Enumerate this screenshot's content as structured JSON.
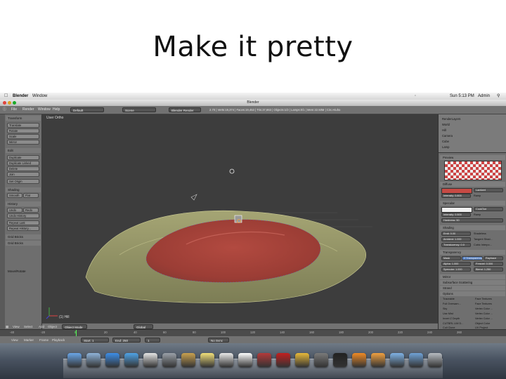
{
  "slide": {
    "title": "Make it pretty"
  },
  "mac_menubar": {
    "app_name": "Blender",
    "menu": "Window",
    "clock": "Sun 5:13 PM",
    "user": "Admin"
  },
  "window": {
    "title": "Blender"
  },
  "header": {
    "menus": [
      "File",
      "Render",
      "Window",
      "Help"
    ],
    "layout": "Default",
    "scene": "Scene",
    "engine": "Blender Render",
    "stats": "2.70 | Verts:19,374 | Faces:19,453 | Tris:37,863 | Objects:1/3 | Lamps:0/1 | Mem:22.50M | Circ.Hiuho"
  },
  "viewport": {
    "label": "User Ortho",
    "object_label": "(1) Hill"
  },
  "tool_shelf": {
    "panels": [
      {
        "title": "Transform",
        "buttons": [
          "Translate",
          "Rotate",
          "Scale",
          "Mirror"
        ]
      },
      {
        "title": "Edit",
        "buttons": [
          "Duplicate",
          "Duplicate Linked",
          "Delete",
          "Join"
        ]
      },
      {
        "title": "",
        "buttons": [
          "Set Origin"
        ]
      },
      {
        "title": "Shading",
        "buttons": [
          "Smooth",
          "Flat"
        ]
      },
      {
        "title": "History",
        "buttons": [
          "Undo",
          "Redo",
          "Undo History",
          "Repeat Last",
          "Repeat History..."
        ]
      },
      {
        "title": "",
        "buttons": [
          "Grid Bricks",
          "Grid Bricks"
        ]
      },
      {
        "title": "Move/Rotate",
        "buttons": []
      }
    ]
  },
  "viewport_header": {
    "items": [
      "View",
      "Select",
      "Add",
      "Object",
      "Object Mode",
      "Global"
    ]
  },
  "timeline": {
    "ruler": [
      "-40",
      "-20",
      "0",
      "20",
      "40",
      "60",
      "80",
      "100",
      "120",
      "140",
      "160",
      "180",
      "200",
      "220",
      "240",
      "260"
    ],
    "controls": [
      "View",
      "Marker",
      "Frame",
      "Playback",
      "Start",
      "1",
      "End",
      "250",
      "1",
      "No Sync"
    ]
  },
  "outliner": {
    "items": [
      "RenderLayers",
      "World",
      "Hill",
      "Camera",
      "Cube",
      "Lamp"
    ]
  },
  "properties": {
    "sections": [
      "Preview",
      "Diffuse",
      "Specular",
      "Shading",
      "Transparency",
      "Mirror",
      "Subsurface Scattering",
      "Strand",
      "Options"
    ],
    "diffuse": {
      "shader": "Lambert",
      "intensity": "Intensity: 0.800",
      "ramp": "Ramp"
    },
    "specular": {
      "shader": "CookTorr",
      "intensity": "Intensity: 0.500",
      "hardness": "Hardness:",
      "hardness_value": "50",
      "ramp": "Ramp"
    },
    "shading": {
      "emit": "Emit: 0.00",
      "ambient": "Ambient: 1.000",
      "translucency": "Translucency: 0.0",
      "shadeless": "Shadeless",
      "tangent": "Tangent Shad...",
      "cubic": "Cubic Interpo..."
    },
    "transparency": {
      "tabs": [
        "Mask",
        "Z Transparency",
        "Raytrace"
      ],
      "alpha": "Alpha: 1.000",
      "fresnel": "Fresnel: 0.000",
      "specular": "Specular: 1.000",
      "blend": "Blend: 1.250"
    },
    "options": {
      "left": [
        "Traceable",
        "Full Oversam...",
        "Sky",
        "Use Mist",
        "Invert Z Depth",
        "CUTBRL LIM D...",
        "Cull Clone"
      ],
      "right": [
        "Face Textures",
        "Face Textures",
        "Vertex Color ...",
        "Vertex Color ...",
        "Vertex Color ...",
        "Object Color",
        "UV Project"
      ]
    }
  },
  "colors": {
    "terrain": "#8a8a5e",
    "terrain_highlight": "#b4b27a",
    "lake": "#a8433a",
    "viewport_bg": "#3d3d3d"
  },
  "dock": {
    "icons": [
      "finder-icon",
      "mail-icon",
      "app-store-icon",
      "safari-icon",
      "music-icon",
      "preferences-icon",
      "photos-icon",
      "notes-icon",
      "calendar-icon",
      "ical-icon",
      "photo-booth-icon",
      "acrobat-icon",
      "chrome-icon",
      "help-icon",
      "terminal-icon",
      "blender-icon",
      "blender-icon",
      "folder-icon",
      "download-icon",
      "trash-icon"
    ]
  }
}
